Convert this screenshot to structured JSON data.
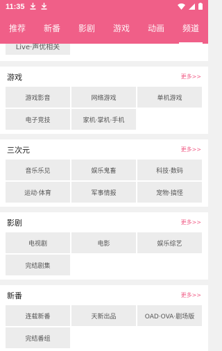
{
  "status": {
    "time": "11:35"
  },
  "nav": {
    "tabs": [
      {
        "label": "推荐"
      },
      {
        "label": "新番"
      },
      {
        "label": "影剧"
      },
      {
        "label": "游戏"
      },
      {
        "label": "动画"
      },
      {
        "label": "频道"
      }
    ],
    "active_index": 5
  },
  "partial": {
    "label": "Live·声优相关"
  },
  "sections": [
    {
      "title": "游戏",
      "more": "更多>>",
      "items": [
        "游戏影音",
        "网络游戏",
        "单机游戏",
        "电子竞技",
        "家机·掌机·手机"
      ]
    },
    {
      "title": "三次元",
      "more": "更多>>",
      "items": [
        "音乐乐见",
        "娱乐鬼畜",
        "科技·数码",
        "运动·体育",
        "军事情报",
        "宠物·搞怪"
      ]
    },
    {
      "title": "影剧",
      "more": "更多>>",
      "items": [
        "电视剧",
        "电影",
        "娱乐综艺",
        "完结剧集"
      ]
    },
    {
      "title": "新番",
      "more": "更多>>",
      "items": [
        "连载新番",
        "天新出品",
        "OAD·OVA·剧场版",
        "完结番组"
      ]
    }
  ],
  "colors": {
    "accent": "#f05f88"
  }
}
